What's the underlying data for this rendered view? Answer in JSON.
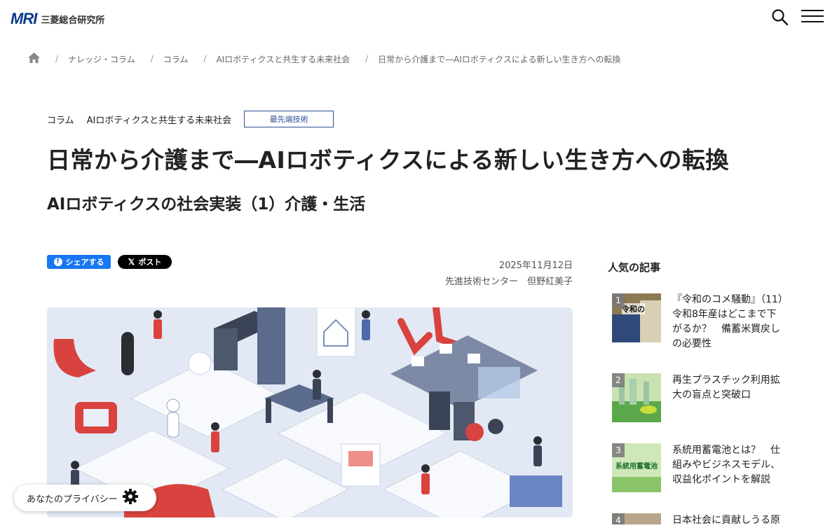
{
  "header": {
    "logo_mark": "MRI",
    "logo_text": "三菱総合研究所",
    "search_icon": "search-icon",
    "menu_icon": "hamburger-menu-icon"
  },
  "breadcrumb": {
    "home_icon": "home-icon",
    "items": [
      "ナレッジ・コラム",
      "コラム",
      "AIロボティクスと共生する未来社会",
      "日常から介護まで―AIロボティクスによる新しい生き方への転換"
    ],
    "separator": "/"
  },
  "article": {
    "tags": [
      "コラム",
      "AIロボティクスと共生する未来社会"
    ],
    "category_badge": "最先端技術",
    "title": "日常から介護まで―AIロボティクスによる新しい生き方への転換",
    "subtitle": "AIロボティクスの社会実装（1）介護・生活",
    "share_facebook": "シェアする",
    "share_x": "ポスト",
    "date": "2025年11月12日",
    "author": "先進技術センター　但野紅美子"
  },
  "sidebar": {
    "heading": "人気の記事",
    "items": [
      {
        "rank": "1",
        "title": "『令和のコメ騒動』（11）令和8年産はどこまで下がるか？　備蓄米買戻しの必要性",
        "thumb_text": "令和の"
      },
      {
        "rank": "2",
        "title": "再生プラスチック利用拡大の盲点と突破口",
        "thumb_text": ""
      },
      {
        "rank": "3",
        "title": "系統用蓄電池とは？　仕組みやビジネスモデル、収益化ポイントを解説",
        "thumb_text": "系統用蓄電池"
      },
      {
        "rank": "4",
        "title": "日本社会に貢献しうる原",
        "thumb_text": ""
      }
    ]
  },
  "privacy": {
    "label": "あなたのプライバシー",
    "icon": "gear-icon"
  },
  "colors": {
    "brand": "#0a3a8c",
    "facebook": "#1877f2",
    "x": "#000000",
    "badge_border": "#2d4f96"
  }
}
